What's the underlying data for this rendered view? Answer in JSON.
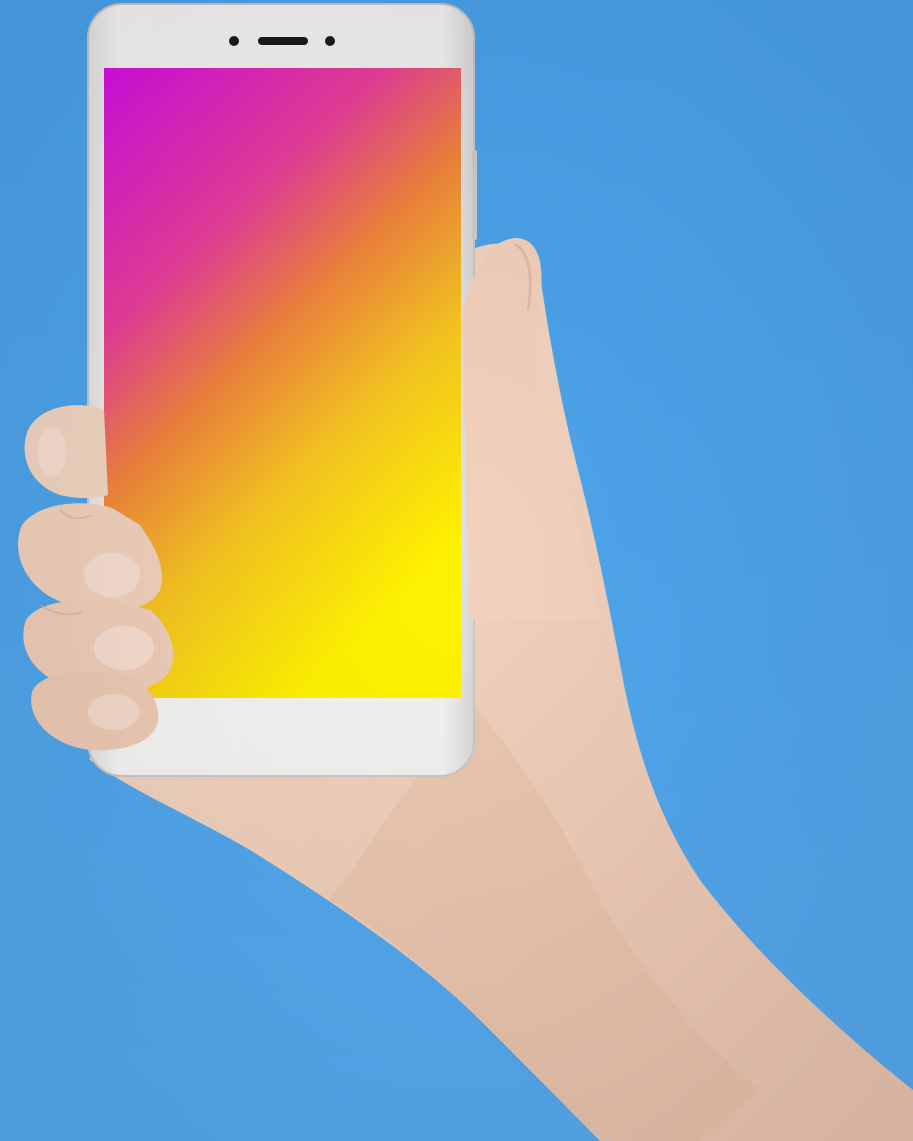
{
  "scene": {
    "background_color": "#4ea5ec",
    "phone_color": "#f3f1ef",
    "screen_gradient": [
      "#d70ee6",
      "#ee4f8a",
      "#f3a52e",
      "#fbe61a",
      "#fff300"
    ],
    "skin_color": "#f1d3be"
  }
}
